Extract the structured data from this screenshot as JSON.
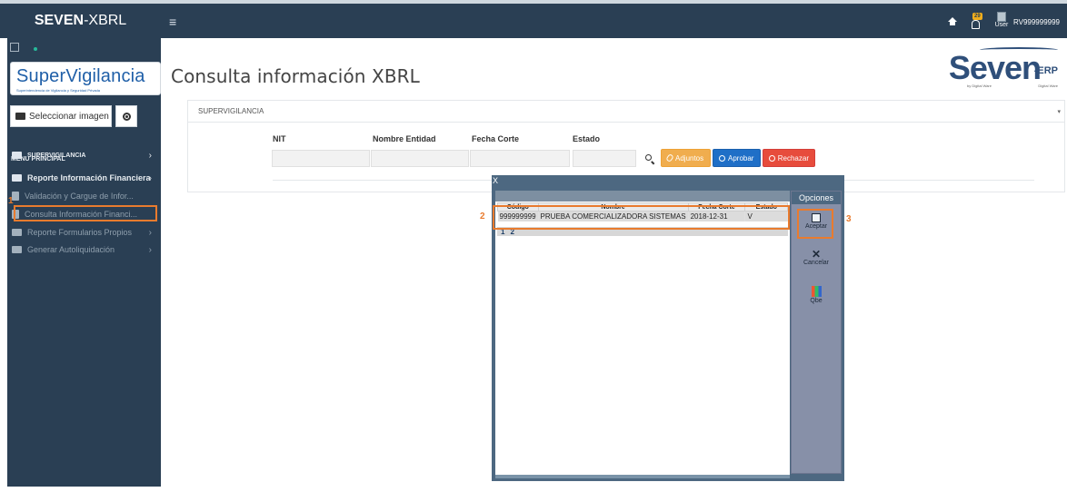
{
  "app": {
    "brand_bold": "SEVEN",
    "brand_rest": "-XBRL",
    "hamburger": "≡",
    "notification_count": "29",
    "user_label": "User",
    "user_name": "RV999999999"
  },
  "sidebar": {
    "logo_text": "SuperVigilancia",
    "logo_subtext": "Superintendencia de Vigilancia y Seguridad Privada",
    "select_image_label": "Seleccionar imagen",
    "menu_title": "MENU PRINCIPAL",
    "items": [
      {
        "label": "SUPERVIGILANCIA",
        "arrow": "›"
      },
      {
        "label": "Reporte Información Financiera",
        "arrow": "›"
      },
      {
        "label": "Validación y Cargue de Infor..."
      },
      {
        "label": "Consulta Información Financi..."
      },
      {
        "label": "Reporte Formularios Propios",
        "arrow": "›"
      },
      {
        "label": "Generar Autoliquidación",
        "arrow": "›"
      }
    ]
  },
  "main": {
    "page_title": "Consulta información XBRL",
    "brand_logo": {
      "name": "Seven",
      "suffix": "-ERP",
      "by": "by Digital Ware",
      "company": "Digital Ware"
    },
    "panel_title": "SUPERVIGILANCIA",
    "panel_caret": "▾",
    "filters": {
      "nit_label": "NIT",
      "nombre_label": "Nombre Entidad",
      "fecha_label": "Fecha Corte",
      "estado_label": "Estado"
    },
    "buttons": {
      "adjuntos": "Adjuntos",
      "aprobar": "Aprobar",
      "rechazar": "Rechazar"
    }
  },
  "modal": {
    "close": "X",
    "columns": [
      "Código",
      "Nombre",
      "Fecha Corte",
      "Estado"
    ],
    "rows": [
      {
        "codigo": "999999999",
        "nombre": "PRUEBA COMERCIALIZADORA SISTEMAS",
        "fecha": "2018-12-31",
        "estado": "V"
      }
    ],
    "pages": [
      "1",
      "2"
    ],
    "options_title": "Opciones",
    "aceptar": "Aceptar",
    "cancelar": "Cancelar",
    "qbe": "Qbe"
  },
  "annotations": {
    "one": "1",
    "two": "2",
    "three": "3"
  },
  "colors": {
    "accent": "#e97b2e",
    "sidebar": "#2a3f54",
    "adjuntos": "#f0ad4e",
    "aprobar": "#1f6fc7",
    "rechazar": "#e74c3c"
  }
}
